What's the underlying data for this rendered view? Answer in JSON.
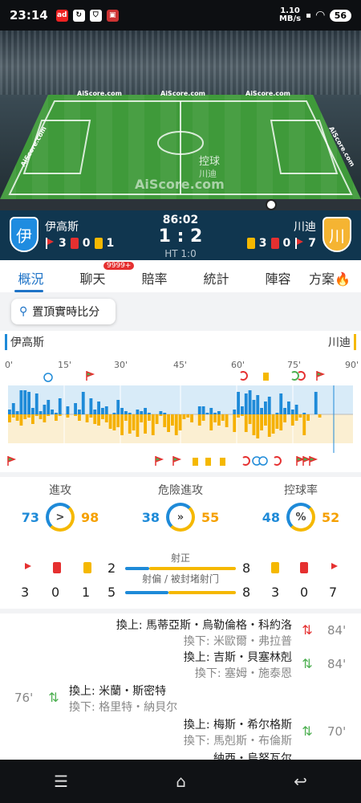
{
  "status_bar": {
    "time": "23:14",
    "speed": "1.10\nMB/s",
    "battery": "56"
  },
  "pitch": {
    "ads": [
      "AiScore.com",
      "AiScore.com",
      "AiScore.com"
    ],
    "side_ads": [
      "AiScore.com",
      "AiScore.com"
    ],
    "watermark": "AiScore.com",
    "possession_label": "控球",
    "possession_team": "川迪"
  },
  "match": {
    "minute": "86:02",
    "score": "1 : 2",
    "half_time": "HT 1:0",
    "home": {
      "name": "伊高斯",
      "crest": "伊",
      "corners": "3",
      "red": "0",
      "yellow": "1"
    },
    "away": {
      "name": "川迪",
      "crest": "川",
      "yellow": "3",
      "red": "0",
      "corners": "7"
    }
  },
  "tabs": [
    {
      "label": "概況"
    },
    {
      "label": "聊天",
      "badge": "9999+"
    },
    {
      "label": "賠率"
    },
    {
      "label": "統計"
    },
    {
      "label": "陣容"
    },
    {
      "label": "方案"
    }
  ],
  "pin_button": "置頂實時比分",
  "timeline": {
    "home": "伊高斯",
    "away": "川迪",
    "minute_labels": [
      "0'",
      "15'",
      "30'",
      "45'",
      "60'",
      "75'",
      "90'"
    ]
  },
  "stats": [
    {
      "title": "進攻",
      "home": "73",
      "away": "98",
      "icon": ">"
    },
    {
      "title": "危險進攻",
      "home": "38",
      "away": "55",
      "icon": "»"
    },
    {
      "title": "控球率",
      "home": "48",
      "away": "52",
      "icon": "%"
    }
  ],
  "shots": {
    "on_target_label": "射正",
    "off_target_label": "射偏 / 被封堵射门",
    "home_on": "2",
    "away_on": "8",
    "home_off": "5",
    "away_off": "8"
  },
  "summary_counts": {
    "home_corners": "3",
    "home_red": "0",
    "home_yellow": "1",
    "away_yellow": "3",
    "away_red": "0",
    "away_corners": "7"
  },
  "substitutions": [
    {
      "in": "換上: 馬蒂亞斯・烏勒倫格・科約洛",
      "out": "換下: 米歐爾・弗拉普",
      "minute": "84'",
      "side": "away"
    },
    {
      "in": "換上: 吉斯・貝塞林剋",
      "out": "換下: 塞姆・施泰恩",
      "minute": "84'",
      "side": "away"
    },
    {
      "in": "換上: 米蘭・斯密特",
      "out": "換下: 格里特・納貝尔",
      "minute": "76'",
      "side": "home"
    },
    {
      "in": "換上: 梅斯・希尔格斯",
      "out": "換下: 馬剋斯・布倫斯",
      "minute": "70'",
      "side": "away"
    },
    {
      "in": "納西・烏努瓦尔",
      "out": "",
      "minute": "",
      "side": "away"
    }
  ],
  "colors": {
    "home": "#1e8ad8",
    "away": "#f5b800",
    "header_bg": "#10364f",
    "accent": "#1e73c7"
  }
}
